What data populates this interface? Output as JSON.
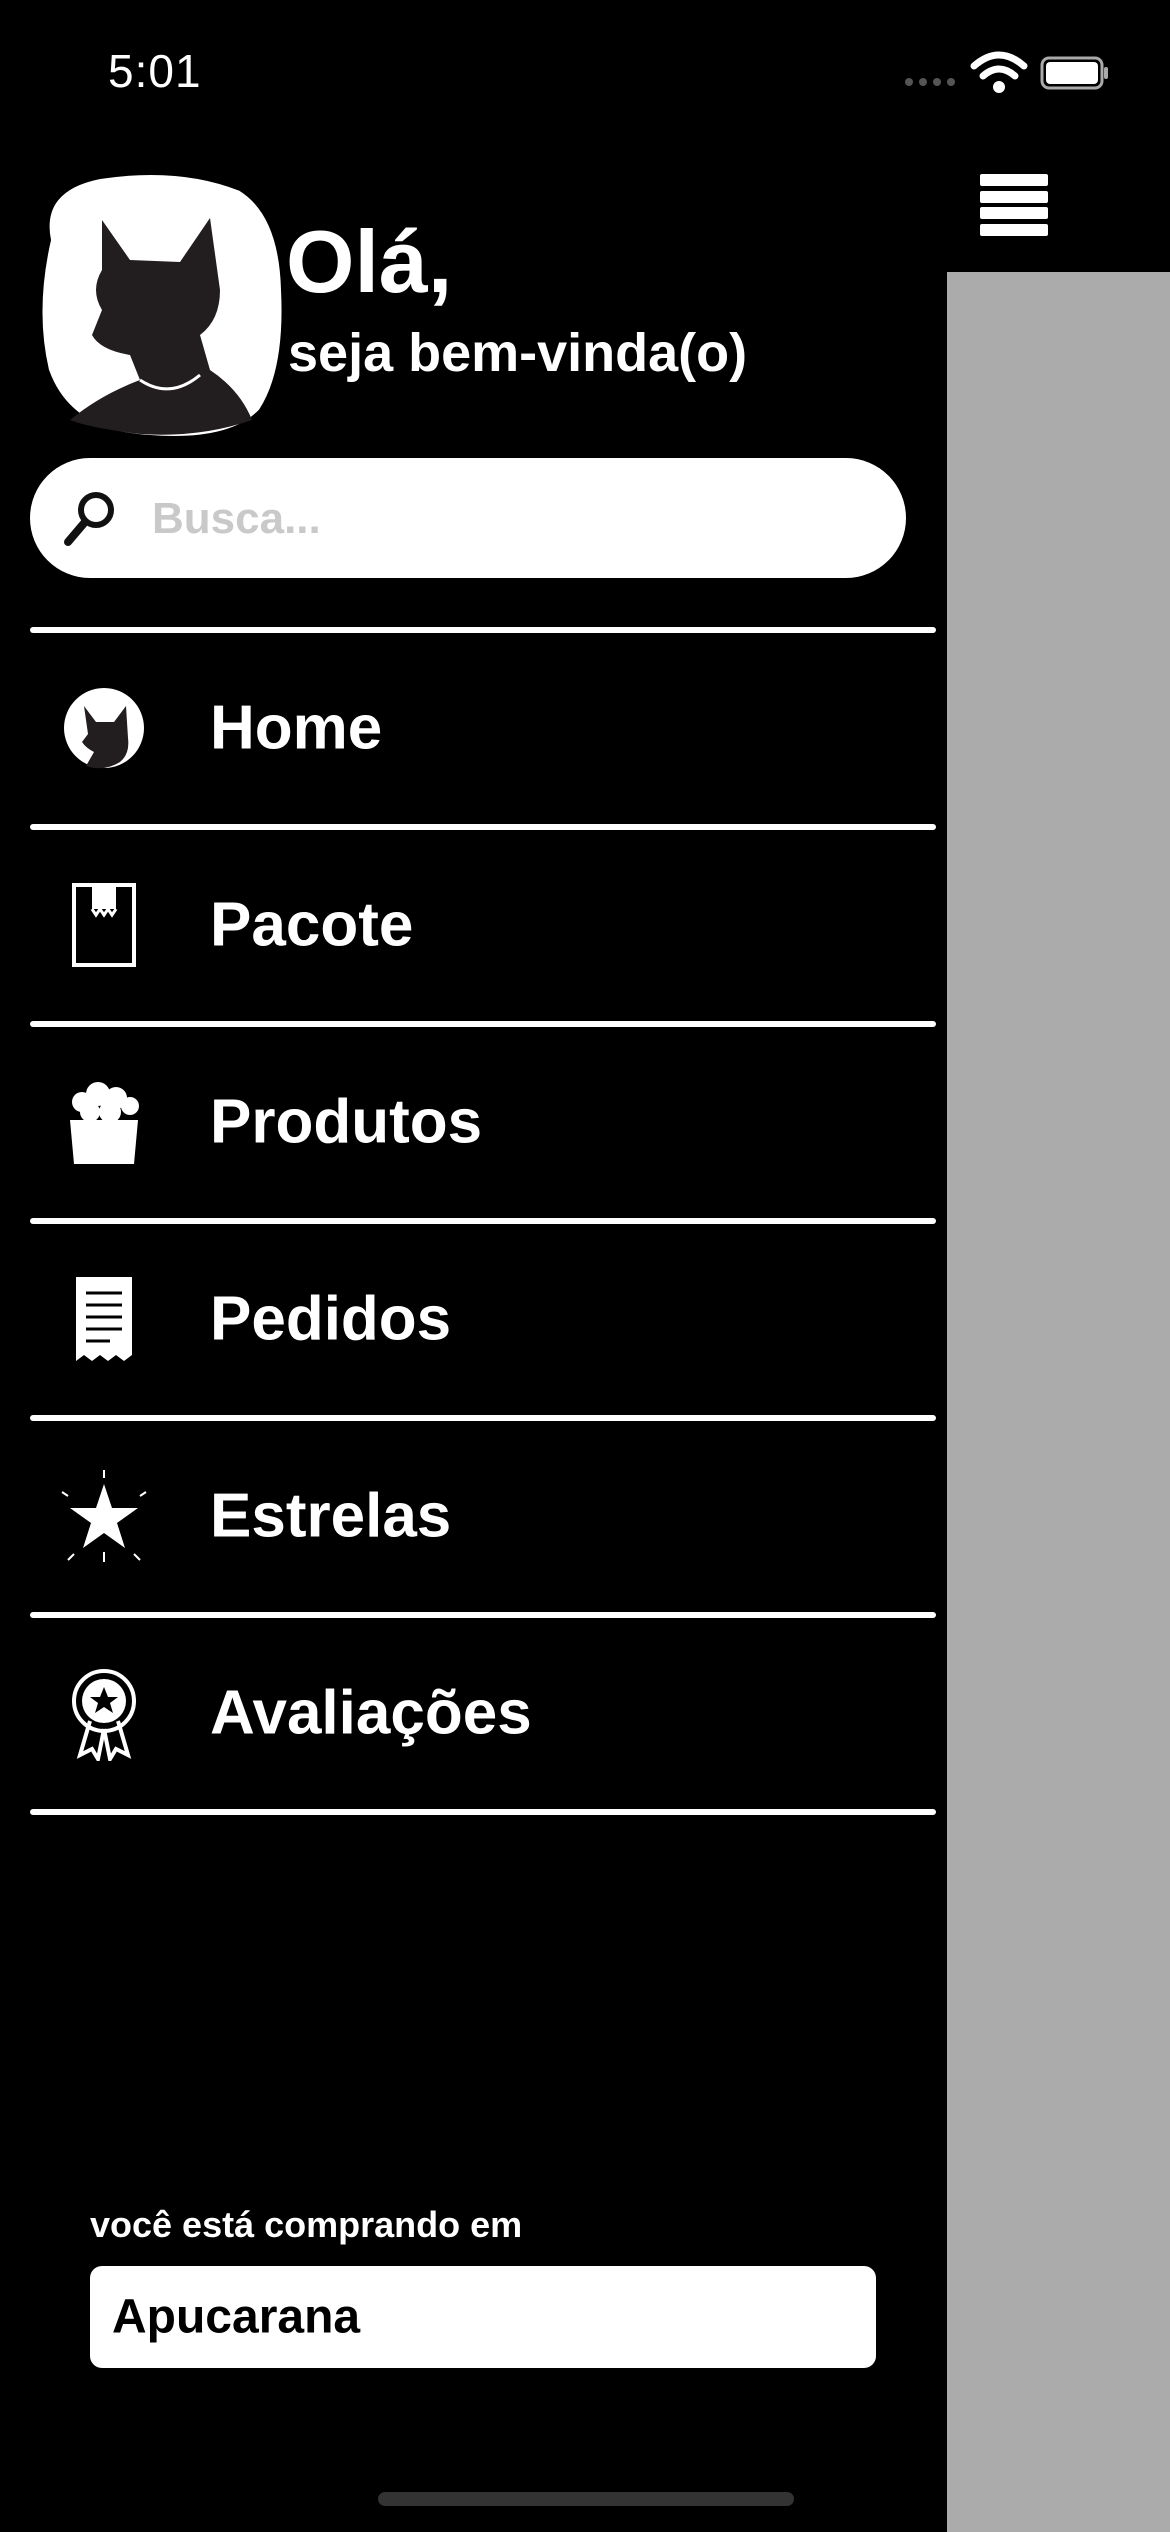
{
  "status_bar": {
    "time": "5:01"
  },
  "header": {
    "greeting": "Olá,",
    "welcome": "seja bem-vinda(o)"
  },
  "search": {
    "placeholder": "Busca..."
  },
  "menu": {
    "items": [
      {
        "label": "Home",
        "icon": "fox-icon"
      },
      {
        "label": "Pacote",
        "icon": "package-icon"
      },
      {
        "label": "Produtos",
        "icon": "products-icon"
      },
      {
        "label": "Pedidos",
        "icon": "receipt-icon"
      },
      {
        "label": "Estrelas",
        "icon": "star-icon"
      },
      {
        "label": "Avaliações",
        "icon": "award-icon"
      }
    ]
  },
  "location": {
    "label": "você está comprando em",
    "city": "Apucarana"
  },
  "colors": {
    "background": "#000000",
    "overlay": "#ababab",
    "text": "#ffffff"
  }
}
